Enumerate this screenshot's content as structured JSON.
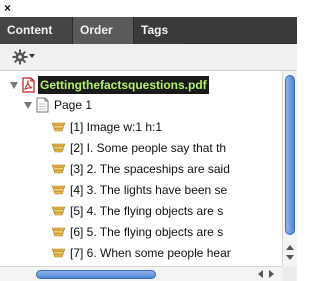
{
  "window": {
    "close_glyph": "×"
  },
  "tabs": [
    {
      "label": "Content",
      "icon": "none"
    },
    {
      "label": "Order",
      "icon": "none",
      "active": true
    },
    {
      "label": "Tags",
      "icon": "none"
    }
  ],
  "options": {
    "icon": "gear-icon"
  },
  "tree": {
    "document": {
      "label": "Gettingthefactsquestions.pdf",
      "icon": "pdf-icon",
      "expanded": true,
      "selected": true
    },
    "page": {
      "label": "Page 1",
      "icon": "page-icon",
      "expanded": true
    },
    "items": [
      {
        "label": "[1]  Image   w:1 h:1"
      },
      {
        "label": "[2]  I. Some people say that th"
      },
      {
        "label": "[3]  2. The spaceships are said"
      },
      {
        "label": "[4]  3. The lights have been se"
      },
      {
        "label": "[5]  4. The flying objects are s"
      },
      {
        "label": "[6]  5. The flying objects are s"
      },
      {
        "label": "[7]  6. When some people hear"
      }
    ]
  },
  "colors": {
    "tabbar_bg": "#3a3a3a",
    "active_tab_bg": "#5a5a5a",
    "selection_bg": "#1a1a1a",
    "selection_text": "#b3f06a",
    "scroll_thumb": "#4f86d6"
  }
}
